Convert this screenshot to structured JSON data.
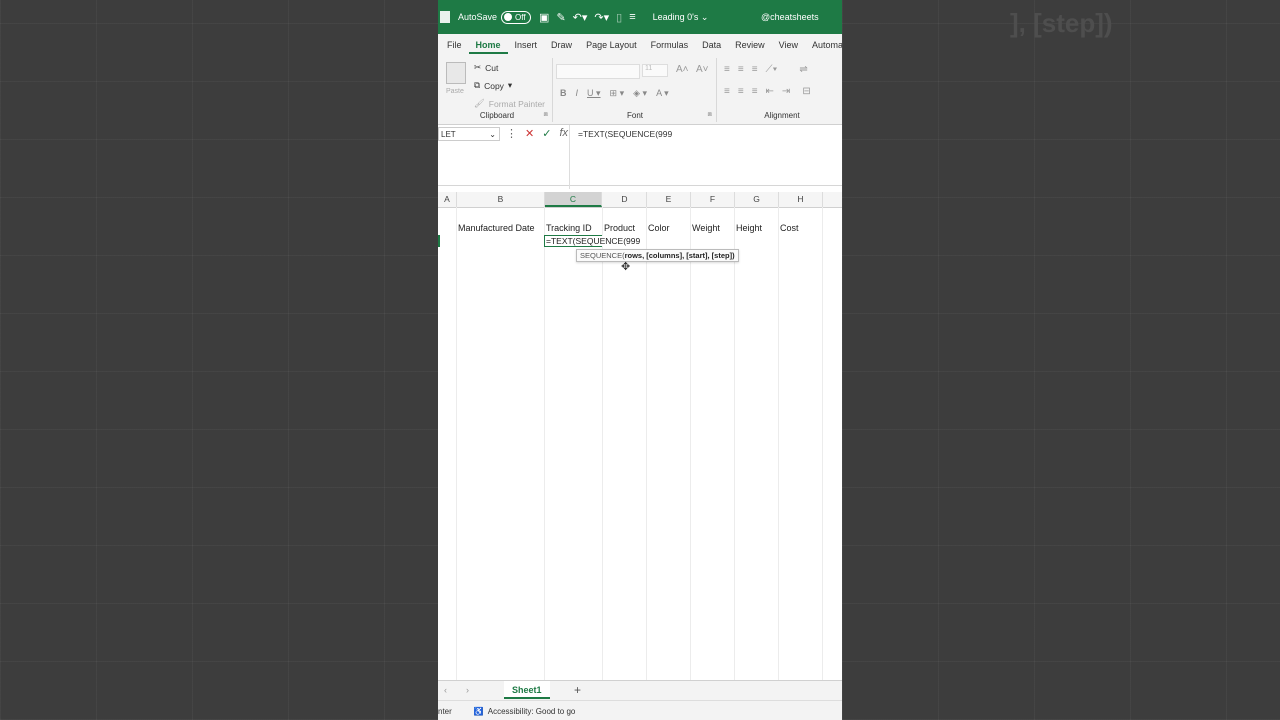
{
  "titlebar": {
    "autosave_label": "AutoSave",
    "autosave_state": "Off",
    "doc_title": "Leading 0's",
    "handle": "@cheatsheets"
  },
  "tabs": [
    "File",
    "Home",
    "Insert",
    "Draw",
    "Page Layout",
    "Formulas",
    "Data",
    "Review",
    "View",
    "Automate"
  ],
  "ribbon": {
    "paste": "Paste",
    "cut": "Cut",
    "copy": "Copy",
    "format_painter": "Format Painter",
    "clipboard_label": "Clipboard",
    "font_size": "11",
    "font_label": "Font",
    "alignment_label": "Alignment"
  },
  "formula_bar": {
    "name_box": "LET",
    "formula": "=TEXT(SEQUENCE(999"
  },
  "columns": [
    "A",
    "B",
    "C",
    "D",
    "E",
    "F",
    "G",
    "H"
  ],
  "headers_row": {
    "b": "Manufactured Date",
    "c": "Tracking ID",
    "d": "Product",
    "e": "Color",
    "f": "Weight",
    "g": "Height",
    "h": "Cost"
  },
  "editing_cell": "=TEXT(SEQUENCE(999",
  "tooltip": {
    "fn": "SEQUENCE(",
    "args": "rows, [columns], [start], [step])"
  },
  "sheet": {
    "name": "Sheet1",
    "add": "+"
  },
  "status": {
    "mode": "nter",
    "accessibility": "Accessibility: Good to go"
  },
  "background": {
    "ghost_text": "], [step])"
  },
  "colors": {
    "accent": "#1e7a45"
  }
}
